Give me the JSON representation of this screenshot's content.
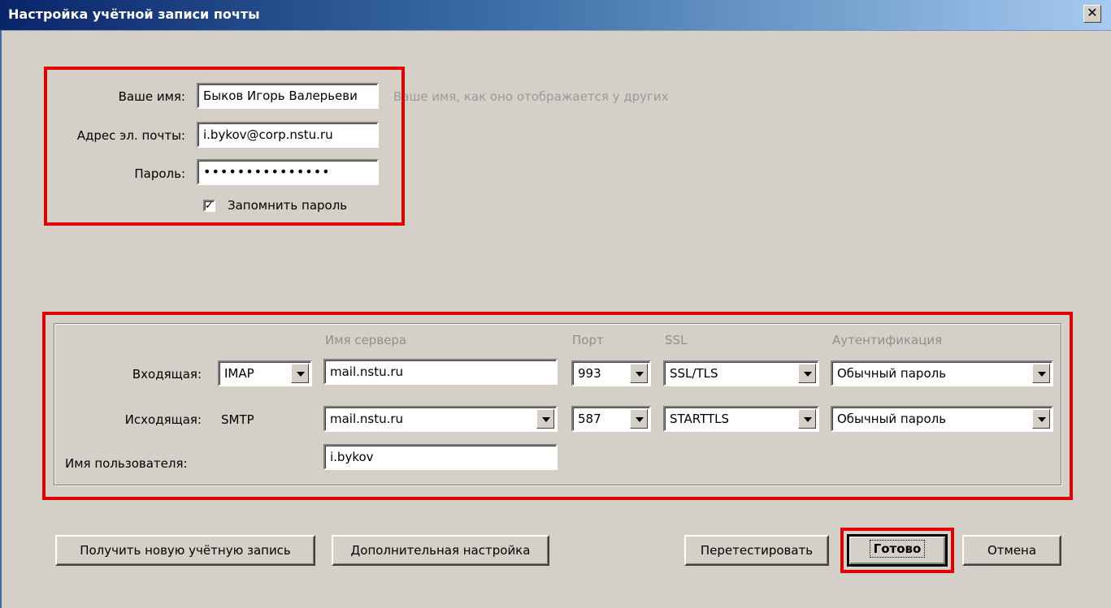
{
  "window": {
    "title": "Настройка учётной записи почты",
    "close_glyph": "✕"
  },
  "identity": {
    "name_label": "Ваше имя:",
    "name_value": "Быков Игорь Валерьеви",
    "name_hint": "Ваше имя, как оно отображается у других",
    "email_label": "Адрес эл. почты:",
    "email_value": "i.bykov@corp.nstu.ru",
    "password_label": "Пароль:",
    "password_value": "•••••••••••••••",
    "remember_label": "Запомнить пароль",
    "remember_checked": "✓"
  },
  "server": {
    "headers": {
      "server_name": "Имя сервера",
      "port": "Порт",
      "ssl": "SSL",
      "auth": "Аутентификация"
    },
    "incoming": {
      "label": "Входящая:",
      "protocol": "IMAP",
      "server": "mail.nstu.ru",
      "port": "993",
      "ssl": "SSL/TLS",
      "auth": "Обычный пароль"
    },
    "outgoing": {
      "label": "Исходящая:",
      "protocol": "SMTP",
      "server": "mail.nstu.ru",
      "port": "587",
      "ssl": "STARTTLS",
      "auth": "Обычный пароль"
    },
    "username": {
      "label": "Имя пользователя:",
      "value": "i.bykov"
    }
  },
  "buttons": {
    "new_account": "Получить новую учётную запись",
    "advanced": "Дополнительная настройка",
    "retest": "Перетестировать",
    "done": "Готово",
    "cancel": "Отмена"
  },
  "colors": {
    "highlight": "#e00000",
    "dialog_bg": "#d4d0c8"
  }
}
